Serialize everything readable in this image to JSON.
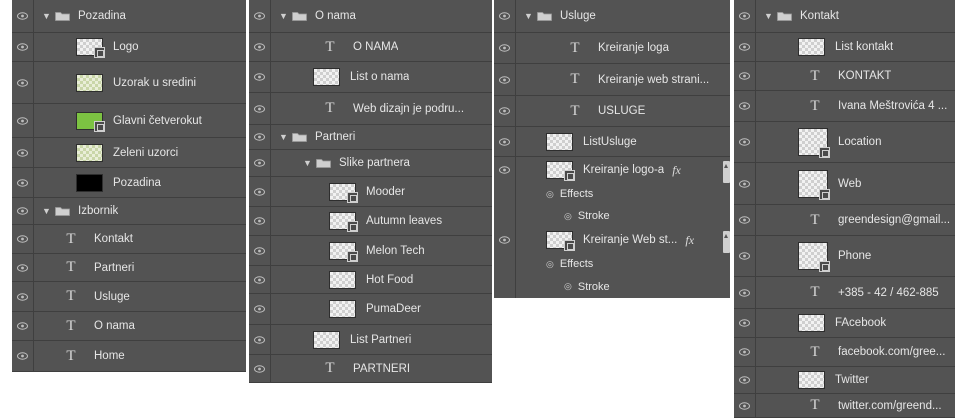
{
  "panels": [
    {
      "rows": [
        {
          "kind": "group",
          "label": "Pozadina",
          "expanded": true
        },
        {
          "kind": "image",
          "label": "Logo",
          "thumb": "checker",
          "smart": true
        },
        {
          "kind": "image",
          "label": "Uzorak u sredini",
          "thumb": "green-tex"
        },
        {
          "kind": "image",
          "label": "Glavni četverokut",
          "thumb": "green",
          "smart": true
        },
        {
          "kind": "image",
          "label": "Zeleni uzorci",
          "thumb": "green-tex"
        },
        {
          "kind": "image",
          "label": "Pozadina",
          "thumb": "black"
        },
        {
          "kind": "group",
          "label": "Izbornik",
          "expanded": true
        },
        {
          "kind": "text",
          "label": "Kontakt"
        },
        {
          "kind": "text",
          "label": "Partneri"
        },
        {
          "kind": "text",
          "label": "Usluge"
        },
        {
          "kind": "text",
          "label": "O nama"
        },
        {
          "kind": "text",
          "label": "Home"
        }
      ]
    },
    {
      "rows": [
        {
          "kind": "group",
          "label": "O nama",
          "expanded": true
        },
        {
          "kind": "text",
          "label": "O NAMA"
        },
        {
          "kind": "image",
          "label": "List o nama",
          "thumb": "checker"
        },
        {
          "kind": "text",
          "label": "Web dizajn je podru..."
        },
        {
          "kind": "group",
          "label": "Partneri",
          "expanded": true
        },
        {
          "kind": "group",
          "label": "Slike partnera",
          "expanded": true
        },
        {
          "kind": "image",
          "label": "Mooder",
          "thumb": "checker",
          "smart": true
        },
        {
          "kind": "image",
          "label": "Autumn leaves",
          "thumb": "checker",
          "smart": true
        },
        {
          "kind": "image",
          "label": "Melon Tech",
          "thumb": "checker",
          "smart": true
        },
        {
          "kind": "image",
          "label": "Hot Food",
          "thumb": "checker"
        },
        {
          "kind": "image",
          "label": "PumaDeer",
          "thumb": "checker"
        },
        {
          "kind": "image",
          "label": "List Partneri",
          "thumb": "checker"
        },
        {
          "kind": "text",
          "label": "PARTNERI"
        }
      ]
    },
    {
      "rows": [
        {
          "kind": "group",
          "label": "Usluge",
          "expanded": true
        },
        {
          "kind": "text",
          "label": "Kreiranje loga"
        },
        {
          "kind": "text",
          "label": "Kreiranje web strani..."
        },
        {
          "kind": "text",
          "label": "USLUGE"
        },
        {
          "kind": "image",
          "label": "ListUsluge",
          "thumb": "checker"
        },
        {
          "kind": "image",
          "label": "Kreiranje logo-a",
          "thumb": "checker",
          "smart": true,
          "fx": "fx"
        },
        {
          "kind": "effects",
          "label": "Effects"
        },
        {
          "kind": "effect",
          "label": "Stroke"
        },
        {
          "kind": "image",
          "label": "Kreiranje Web st...",
          "thumb": "checker",
          "smart": true,
          "fx": "fx"
        },
        {
          "kind": "effects",
          "label": "Effects"
        },
        {
          "kind": "effect",
          "label": "Stroke"
        }
      ]
    },
    {
      "rows": [
        {
          "kind": "group",
          "label": "Kontakt",
          "expanded": true
        },
        {
          "kind": "image",
          "label": "List kontakt",
          "thumb": "checker"
        },
        {
          "kind": "text",
          "label": "KONTAKT"
        },
        {
          "kind": "text",
          "label": "Ivana Meštrovića 4 ..."
        },
        {
          "kind": "image",
          "label": "Location",
          "thumb": "checker",
          "smart": true,
          "tall": true
        },
        {
          "kind": "image",
          "label": "Web",
          "thumb": "checker",
          "smart": true,
          "tall": true
        },
        {
          "kind": "text",
          "label": "greendesign@gmail..."
        },
        {
          "kind": "image",
          "label": "Phone",
          "thumb": "checker",
          "smart": true,
          "tall": true
        },
        {
          "kind": "text",
          "label": "+385 - 42 / 462-885"
        },
        {
          "kind": "image",
          "label": "FAcebook",
          "thumb": "checker"
        },
        {
          "kind": "text",
          "label": "facebook.com/gree..."
        },
        {
          "kind": "image",
          "label": "Twitter",
          "thumb": "checker"
        },
        {
          "kind": "text",
          "label": "twitter.com/greend..."
        }
      ]
    }
  ]
}
